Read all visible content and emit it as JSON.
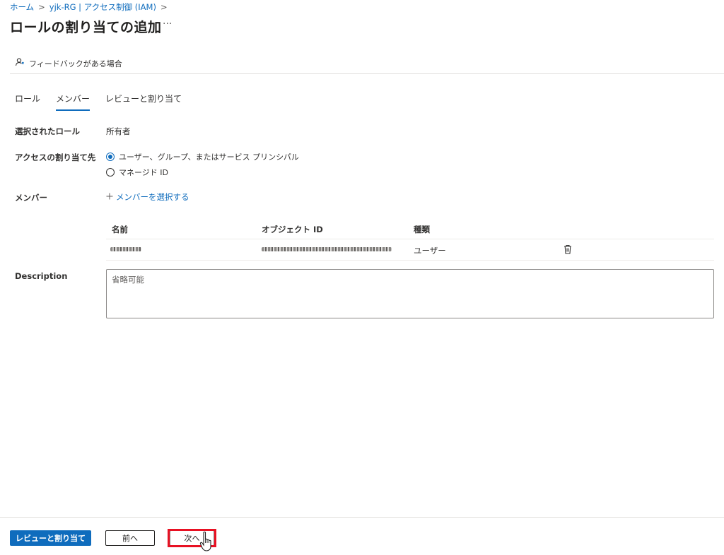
{
  "breadcrumb": {
    "items": [
      "ホーム",
      "yjk-RG | アクセス制御 (IAM)"
    ],
    "separator": ">"
  },
  "page": {
    "title": "ロールの割り当ての追加",
    "more": "···"
  },
  "feedback": {
    "label": "フィードバックがある場合"
  },
  "tabs": [
    {
      "label": "ロール",
      "active": false
    },
    {
      "label": "メンバー",
      "active": true
    },
    {
      "label": "レビューと割り当て",
      "active": false
    }
  ],
  "form": {
    "selected_role": {
      "label": "選択されたロール",
      "value": "所有者"
    },
    "assign_to": {
      "label": "アクセスの割り当て先",
      "options": [
        {
          "label": "ユーザー、グループ、またはサービス プリンシパル",
          "selected": true
        },
        {
          "label": "マネージド ID",
          "selected": false
        }
      ]
    },
    "members": {
      "label": "メンバー",
      "add_link": "メンバーを選択する"
    },
    "description": {
      "label": "Description",
      "placeholder": "省略可能"
    }
  },
  "members_table": {
    "columns": [
      "名前",
      "オブジェクト ID",
      "種類"
    ],
    "rows": [
      {
        "type": "ユーザー"
      }
    ]
  },
  "footer": {
    "review_assign": "レビューと割り当て",
    "previous": "前へ",
    "next": "次へ"
  },
  "colors": {
    "accent": "#0f6cbd",
    "highlight": "#e81123"
  },
  "icons": [
    "chevron-right-icon",
    "feedback-icon",
    "plus-icon",
    "delete-icon",
    "hand-cursor-icon"
  ]
}
